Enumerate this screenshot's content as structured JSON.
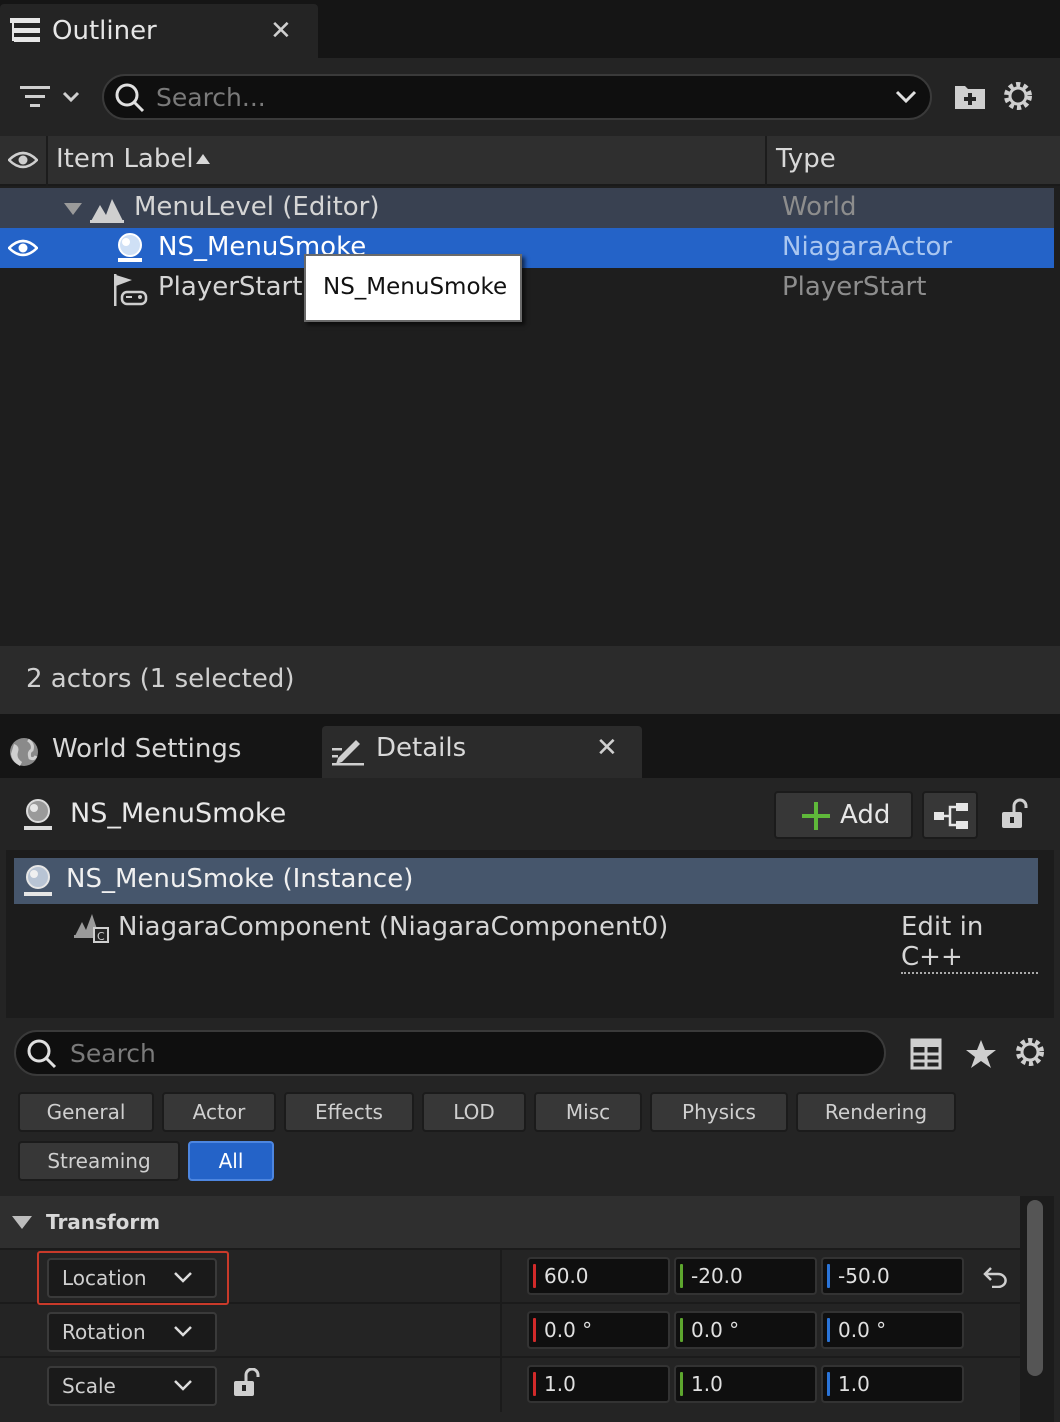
{
  "outliner": {
    "tab_title": "Outliner",
    "close_glyph": "✕",
    "search_placeholder": "Search...",
    "columns": {
      "label": "Item Label",
      "type": "Type"
    },
    "rows": [
      {
        "label": "MenuLevel (Editor)",
        "type": "World",
        "icon": "level-icon"
      },
      {
        "label": "NS_MenuSmoke",
        "type": "NiagaraActor",
        "icon": "niagara-actor-icon",
        "selected": true
      },
      {
        "label": "PlayerStart",
        "type": "PlayerStart",
        "icon": "player-start-icon"
      }
    ],
    "tooltip": "NS_MenuSmoke",
    "status": "2 actors (1 selected)"
  },
  "tabs": {
    "world_settings": "World Settings",
    "details": "Details",
    "close_glyph": "✕"
  },
  "details": {
    "actor_name": "NS_MenuSmoke",
    "add_label": "Add",
    "components": {
      "instance": "NS_MenuSmoke (Instance)",
      "niagara": "NiagaraComponent (NiagaraComponent0)",
      "edit_link": "Edit in C++"
    },
    "search_placeholder": "Search",
    "categories": [
      "General",
      "Actor",
      "Effects",
      "LOD",
      "Misc",
      "Physics",
      "Rendering",
      "Streaming",
      "All"
    ],
    "active_category": "All",
    "transform": {
      "title": "Transform",
      "location": {
        "label": "Location",
        "x": "60.0",
        "y": "-20.0",
        "z": "-50.0"
      },
      "rotation": {
        "label": "Rotation",
        "x": "0.0 °",
        "y": "0.0 °",
        "z": "0.0 °"
      },
      "scale": {
        "label": "Scale",
        "x": "1.0",
        "y": "1.0",
        "z": "1.0"
      }
    }
  },
  "colors": {
    "selection": "#2463c8",
    "row_highlight": "#394151",
    "axis_x": "#d22a2a",
    "axis_y": "#5da62e",
    "axis_z": "#2a74d8",
    "annotation": "#c93a2a"
  }
}
